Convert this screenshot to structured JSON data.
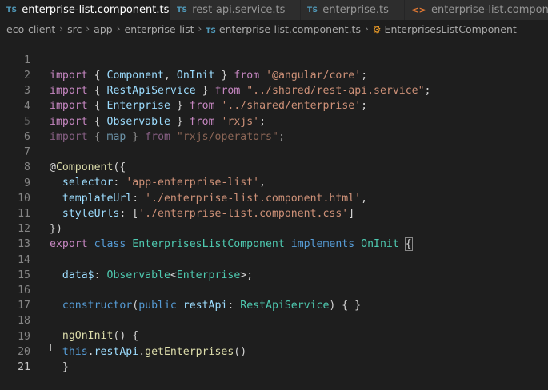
{
  "tabs": [
    {
      "icon": "TS",
      "label": "enterprise-list.component.ts",
      "active": true,
      "dirty": true
    },
    {
      "icon": "TS",
      "label": "rest-api.service.ts",
      "active": false
    },
    {
      "icon": "TS",
      "label": "enterprise.ts",
      "active": false
    },
    {
      "icon": "<>",
      "label": "enterprise-list.component.html",
      "active": false
    }
  ],
  "breadcrumb": {
    "items": [
      "eco-client",
      "src",
      "app",
      "enterprise-list"
    ],
    "file_icon": "TS",
    "file": "enterprise-list.component.ts",
    "symbol": "EnterprisesListComponent"
  },
  "editor": {
    "line_numbers": [
      "1",
      "2",
      "3",
      "4",
      "5",
      "6",
      "7",
      "8",
      "9",
      "10",
      "11",
      "12",
      "13",
      "14",
      "15",
      "16",
      "17",
      "18",
      "19",
      "20",
      "21"
    ],
    "active_line": "21",
    "t": {
      "import": "import",
      "lb": "{",
      "rb": "}",
      "from": "from",
      "semi": ";",
      "comma": ",",
      "Component": "Component",
      "OnInit": "OnInit",
      "angular_core": "'@angular/core'",
      "RestApiService": "RestApiService",
      "rest_api_path": "\"../shared/rest-api.service\"",
      "Enterprise": "Enterprise",
      "enterprise_path": "'../shared/enterprise'",
      "Observable": "Observable",
      "rxjs": "'rxjs'",
      "map": "map",
      "rxjs_ops": "\"rxjs/operators\"",
      "at": "@",
      "lparen_brace": "({",
      "selector": "selector",
      "colon": ":",
      "selector_val": "'app-enterprise-list'",
      "templateUrl": "templateUrl",
      "template_val": "'./enterprise-list.component.html'",
      "styleUrls": "styleUrls",
      "lbr": "[",
      "style_val": "'./enterprise-list.component.css'",
      "rbr": "]",
      "close_deco": "})",
      "export": "export",
      "class": "class",
      "EnterprisesListComponent": "EnterprisesListComponent",
      "implements": "implements",
      "data": "data$",
      "lt": "<",
      "gt_semi": ">;",
      "constructor": "constructor",
      "lparen": "(",
      "public": "public",
      "restApi": "restApi",
      "rparen_braces": ") { }",
      "ngOnInit": "ngOnInit",
      "parens_brace": "() {",
      "this": "this",
      "dot": ".",
      "getEnterprises": "getEnterprises",
      "parens": "()",
      "sp": " ",
      "ind2": "  ",
      "ind4": "    "
    }
  }
}
